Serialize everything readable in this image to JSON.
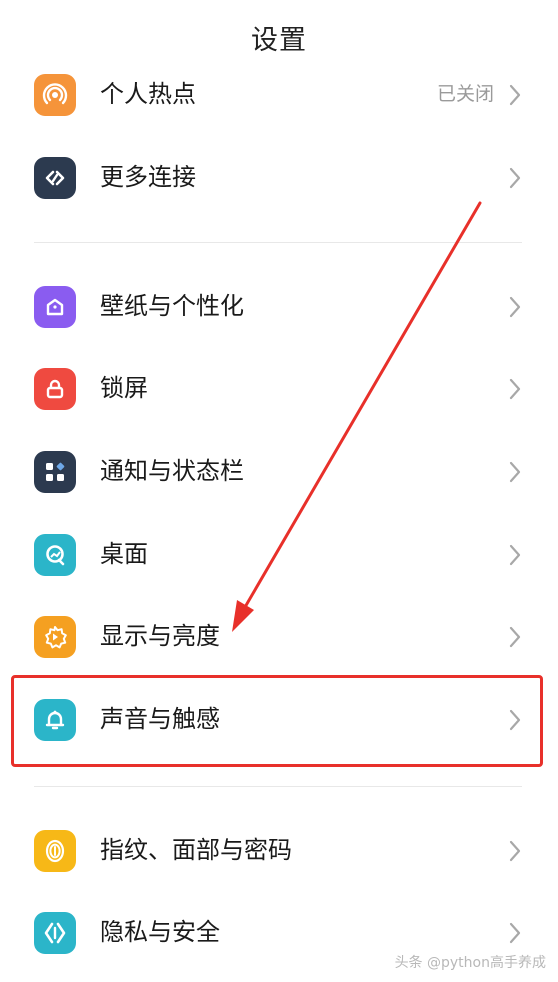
{
  "header": {
    "title": "设置"
  },
  "items": [
    {
      "label": "个人热点",
      "status": "已关闭",
      "color": "#f5943a",
      "icon": "hotspot-icon"
    },
    {
      "label": "更多连接",
      "status": "",
      "color": "#2c3a4f",
      "icon": "link-icon"
    },
    {
      "label": "壁纸与个性化",
      "status": "",
      "color": "#8a5cf0",
      "icon": "wallpaper-icon"
    },
    {
      "label": "锁屏",
      "status": "",
      "color": "#ef4a40",
      "icon": "lock-icon"
    },
    {
      "label": "通知与状态栏",
      "status": "",
      "color": "#2c3a4f",
      "icon": "notification-grid-icon"
    },
    {
      "label": "桌面",
      "status": "",
      "color": "#2bb5c9",
      "icon": "home-screen-icon"
    },
    {
      "label": "显示与亮度",
      "status": "",
      "color": "#f5a021",
      "icon": "brightness-icon"
    },
    {
      "label": "声音与触感",
      "status": "",
      "color": "#2bb5c9",
      "icon": "bell-icon"
    },
    {
      "label": "指纹、面部与密码",
      "status": "",
      "color": "#f7b817",
      "icon": "fingerprint-icon"
    },
    {
      "label": "隐私与安全",
      "status": "",
      "color": "#2bb5c9",
      "icon": "privacy-shield-icon"
    }
  ],
  "annotation": {
    "color": "#e8302a"
  },
  "watermark": "头条 @python高手养成"
}
